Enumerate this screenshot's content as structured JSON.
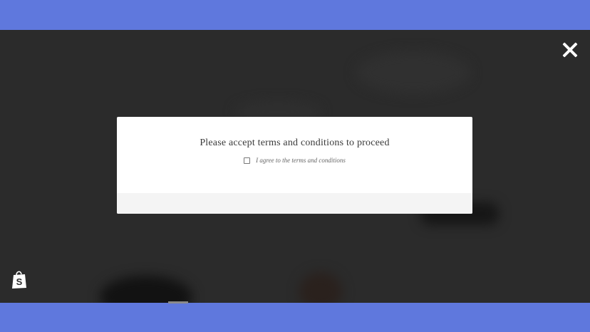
{
  "modal": {
    "title": "Please accept terms and conditions to proceed",
    "agree_label": "I agree to the terms and conditions",
    "agree_checked": false
  },
  "icons": {
    "close": "close-icon",
    "shop": "shopify-bag-icon"
  },
  "colors": {
    "frame": "#5f78dd",
    "overlay": "#2b2b2b",
    "modal": "#ffffff",
    "modal_footer": "#f4f4f4"
  }
}
